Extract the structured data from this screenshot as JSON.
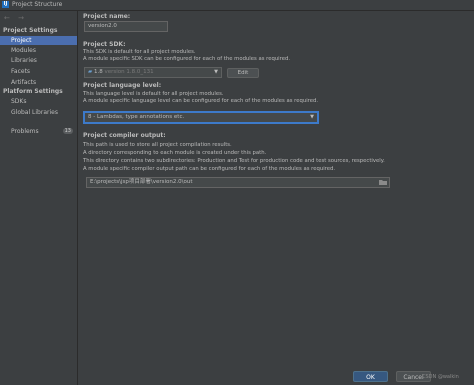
{
  "window": {
    "title": "Project Structure"
  },
  "sidebar": {
    "nav": "← →",
    "sections": [
      {
        "heading": "Project Settings",
        "items": [
          "Project",
          "Modules",
          "Libraries",
          "Facets",
          "Artifacts"
        ]
      },
      {
        "heading": "Platform Settings",
        "items": [
          "SDKs",
          "Global Libraries"
        ]
      }
    ],
    "problems": {
      "label": "Problems",
      "count": "13"
    },
    "selected": "Project"
  },
  "main": {
    "name": {
      "label": "Project name:",
      "value": "version2.0"
    },
    "sdk": {
      "label": "Project SDK:",
      "desc": "This SDK is default for all project modules.",
      "desc2": "A module specific SDK can be configured for each of the modules as required.",
      "value": "1.8",
      "version": "version 1.8.0_131",
      "edit_label": "Edit"
    },
    "language": {
      "label": "Project language level:",
      "desc": "This language level is default for all project modules.",
      "desc2": "A module specific language level can be configured for each of the modules as required.",
      "value": "8 - Lambdas, type annotations etc."
    },
    "output": {
      "label": "Project compiler output:",
      "lines": [
        "This path is used to store all project compilation results.",
        "A directory corresponding to each module is created under this path.",
        "This directory contains two subdirectories: Production and Test for production code and test sources, respectively.",
        "A module specific compiler output path can be configured for each of the modules as required."
      ],
      "path": "E:\\projects\\jsp项目部署\\version2.0\\out"
    }
  },
  "footer": {
    "ok": "OK",
    "cancel": "Cancel",
    "watermark": "CSDN @walkin"
  },
  "colors": {
    "selection": "#4b6eaf",
    "ok_button": "#365880",
    "focus": "#3d7ac9"
  }
}
